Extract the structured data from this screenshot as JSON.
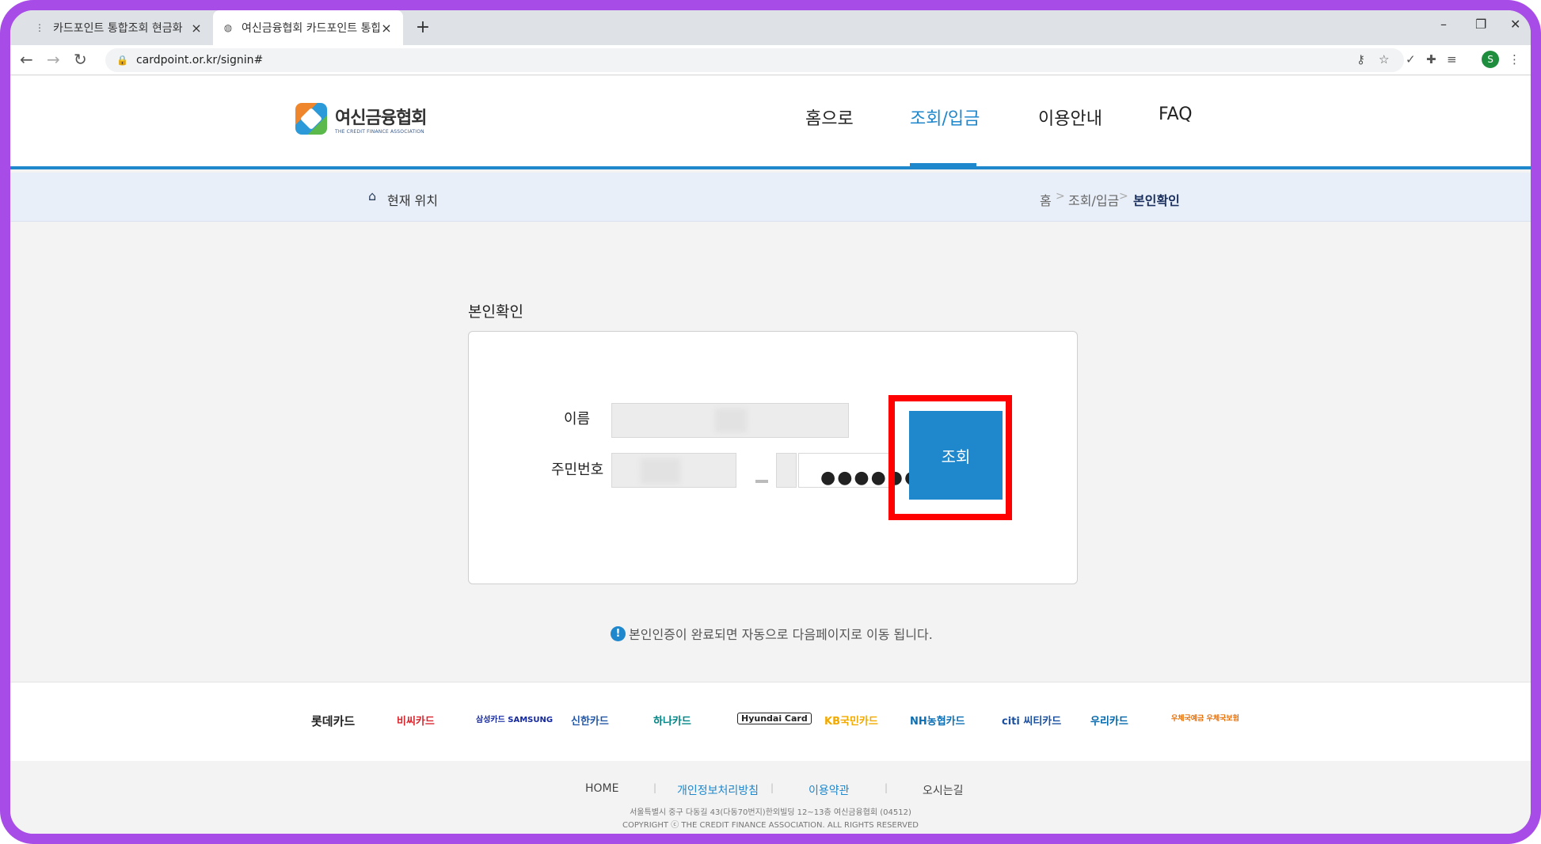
{
  "browser": {
    "tabs": [
      {
        "title": "카드포인트 통합조회 현금화",
        "active": false
      },
      {
        "title": "여신금융협회 카드포인트 통합조",
        "active": true
      }
    ],
    "new_tab": "+",
    "url": "cardpoint.or.kr/signin#",
    "profile_initial": "S"
  },
  "site": {
    "logo_name": "여신금융협회",
    "logo_sub": "THE CREDIT FINANCE ASSOCIATION",
    "nav": [
      "홈으로",
      "조회/입금",
      "이용안내",
      "FAQ"
    ],
    "active_nav": "조회/입금"
  },
  "location": {
    "label": "현재 위치",
    "breadcrumb": [
      "홈",
      "조회/입금",
      "본인확인"
    ]
  },
  "form": {
    "title": "본인확인",
    "name_label": "이름",
    "rrn_label": "주민번호",
    "rrn_masked": "●●●●●●",
    "submit_label": "조회",
    "notice": "본인인증이 완료되면 자동으로 다음페이지로 이동 됩니다."
  },
  "partners": [
    "롯데카드",
    "비씨카드",
    "삼성카드 SAMSUNG",
    "신한카드",
    "하나카드",
    "Hyundai Card",
    "KB국민카드",
    "NH농협카드",
    "citi 씨티카드",
    "우리카드",
    "우체국예금 우체국보험"
  ],
  "footer": {
    "links": [
      "HOME",
      "개인정보처리방침",
      "이용약관",
      "오시는길"
    ],
    "address": "서울특별시 중구 다동길 43(다동70번지)한외빌딩 12~13층 여신금융협회 (04512)",
    "copyright": "COPYRIGHT ⓒ THE CREDIT FINANCE ASSOCIATION. ALL RIGHTS RESERVED"
  },
  "colors": {
    "accent": "#1f87cc",
    "highlight": "#ff0000",
    "frame": "#a84ce8"
  }
}
